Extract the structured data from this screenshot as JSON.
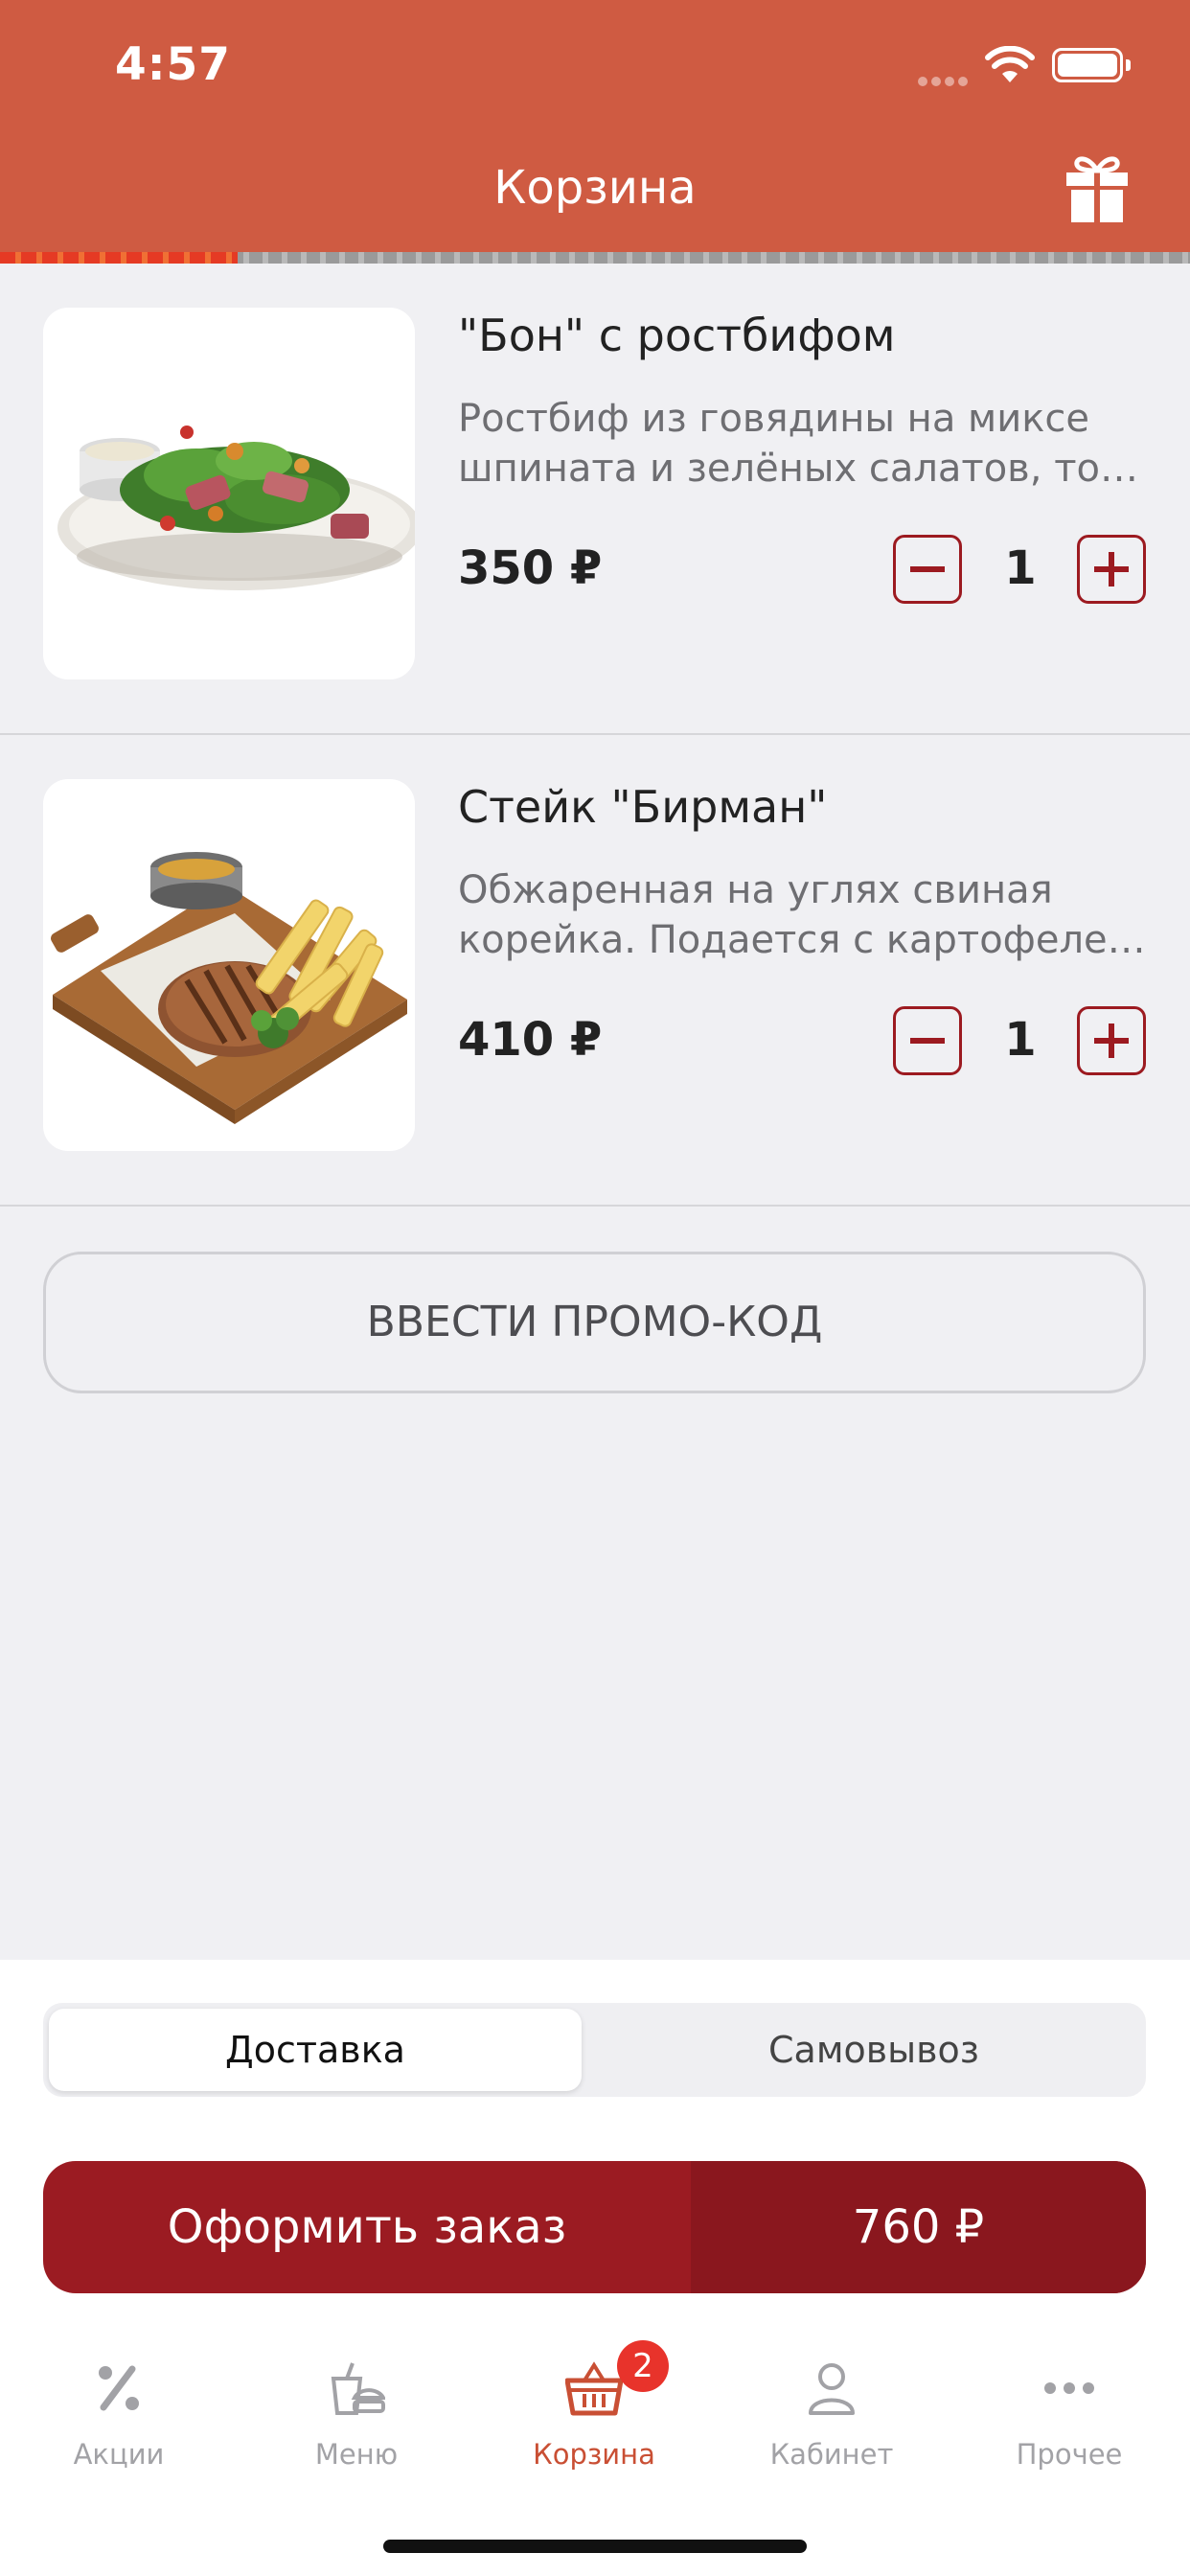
{
  "status": {
    "time": "4:57"
  },
  "header": {
    "title": "Корзина"
  },
  "cart_progress": 0.2,
  "items": [
    {
      "name": "\"Бон\" с ростбифом",
      "desc_line1": "Ростбиф из говядины на миксе",
      "desc_line2": "шпината и зелёных салатов, то…",
      "price": "350 ₽",
      "qty": "1"
    },
    {
      "name": "Стейк \"Бирман\"",
      "desc_line1": "Обжаренная на углях свиная",
      "desc_line2": "корейка. Подается с картофеле…",
      "price": "410 ₽",
      "qty": "1"
    }
  ],
  "promo": {
    "label": "ВВЕСТИ ПРОМО-КОД"
  },
  "delivery_toggle": {
    "options": [
      "Доставка",
      "Самовывоз"
    ],
    "selected": "Доставка"
  },
  "order": {
    "label": "Оформить заказ",
    "total": "760 ₽"
  },
  "tabs": [
    {
      "label": "Акции",
      "icon": "percent-icon"
    },
    {
      "label": "Меню",
      "icon": "menu-food-icon"
    },
    {
      "label": "Корзина",
      "icon": "basket-icon",
      "badge": "2",
      "active": true
    },
    {
      "label": "Кабинет",
      "icon": "user-icon"
    },
    {
      "label": "Прочее",
      "icon": "more-icon"
    }
  ],
  "colors": {
    "header": "#cf5b42",
    "accent": "#9b1b22",
    "active_tab": "#c94f34",
    "badge": "#e8332b"
  }
}
